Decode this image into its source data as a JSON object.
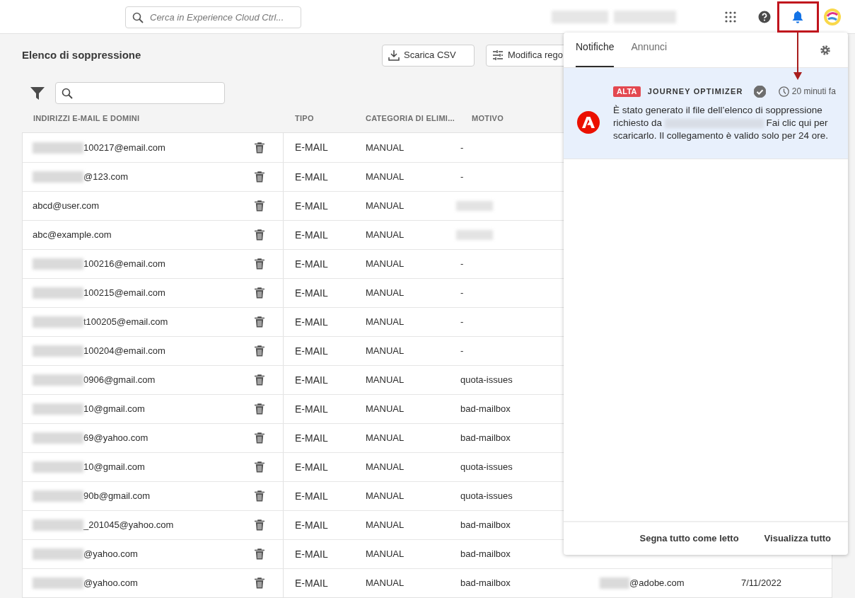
{
  "header": {
    "search": {
      "placeholder": "Cerca in Experience Cloud Ctrl..."
    }
  },
  "page": {
    "title": "Elenco di soppressione",
    "buttons": [
      {
        "label": "Scarica CSV",
        "kind": "download"
      },
      {
        "label": "Modifica rego",
        "kind": "rules"
      }
    ]
  },
  "table": {
    "columns": [
      "INDIRIZZI E-MAIL E DOMINI",
      "TIPO",
      "CATEGORIA DI ELIMI...",
      "MOTIVO"
    ],
    "rows": [
      {
        "address": "100217@email.com",
        "redacted": true,
        "type": "E-MAIL",
        "category": "MANUAL",
        "reason": "-"
      },
      {
        "address": "@123.com",
        "redacted": true,
        "type": "E-MAIL",
        "category": "MANUAL",
        "reason": "-"
      },
      {
        "address": "abcd@user.com",
        "redacted": false,
        "type": "E-MAIL",
        "category": "MANUAL",
        "reason_redacted": true
      },
      {
        "address": "abc@example.com",
        "redacted": false,
        "type": "E-MAIL",
        "category": "MANUAL",
        "reason_redacted": true
      },
      {
        "address": "100216@email.com",
        "redacted": true,
        "type": "E-MAIL",
        "category": "MANUAL",
        "reason": "-"
      },
      {
        "address": "100215@email.com",
        "redacted": true,
        "type": "E-MAIL",
        "category": "MANUAL",
        "reason": "-"
      },
      {
        "address": "t100205@email.com",
        "redacted": true,
        "type": "E-MAIL",
        "category": "MANUAL",
        "reason": "-"
      },
      {
        "address": "100204@email.com",
        "redacted": true,
        "type": "E-MAIL",
        "category": "MANUAL",
        "reason": "-"
      },
      {
        "address": "0906@gmail.com",
        "redacted": true,
        "type": "E-MAIL",
        "category": "MANUAL",
        "reason": "quota-issues"
      },
      {
        "address": "10@gmail.com",
        "redacted": true,
        "type": "E-MAIL",
        "category": "MANUAL",
        "reason": "bad-mailbox"
      },
      {
        "address": "69@yahoo.com",
        "redacted": true,
        "type": "E-MAIL",
        "category": "MANUAL",
        "reason": "bad-mailbox"
      },
      {
        "address": "10@gmail.com",
        "redacted": true,
        "type": "E-MAIL",
        "category": "MANUAL",
        "reason": "quota-issues"
      },
      {
        "address": "90b@gmail.com",
        "redacted": true,
        "type": "E-MAIL",
        "category": "MANUAL",
        "reason": "quota-issues"
      },
      {
        "address": "_201045@yahoo.com",
        "redacted": true,
        "type": "E-MAIL",
        "category": "MANUAL",
        "reason": "bad-mailbox"
      },
      {
        "address": "@yahoo.com",
        "redacted": true,
        "type": "E-MAIL",
        "category": "MANUAL",
        "reason": "bad-mailbox"
      },
      {
        "address": "@yahoo.com",
        "redacted": true,
        "type": "E-MAIL",
        "category": "MANUAL",
        "reason": "bad-mailbox",
        "column_5": "@adobe.com",
        "column_6": "7/11/2022"
      }
    ]
  },
  "notifications": {
    "tabs": [
      {
        "label": "Notifiche",
        "selected": true
      },
      {
        "label": "Annunci",
        "selected": false
      }
    ],
    "items": [
      {
        "priority": "ALTA",
        "source": "JOURNEY OPTIMIZER",
        "read": true,
        "time": "20 minuti fa",
        "text_before": "È stato generato il file dell’elenco di soppressione richiesto da",
        "text_after": "Fai clic qui per scaricarlo. Il collegamento è valido solo per 24 ore."
      }
    ],
    "footer": [
      "Segna tutto come letto",
      "Visualizza tutto"
    ]
  }
}
